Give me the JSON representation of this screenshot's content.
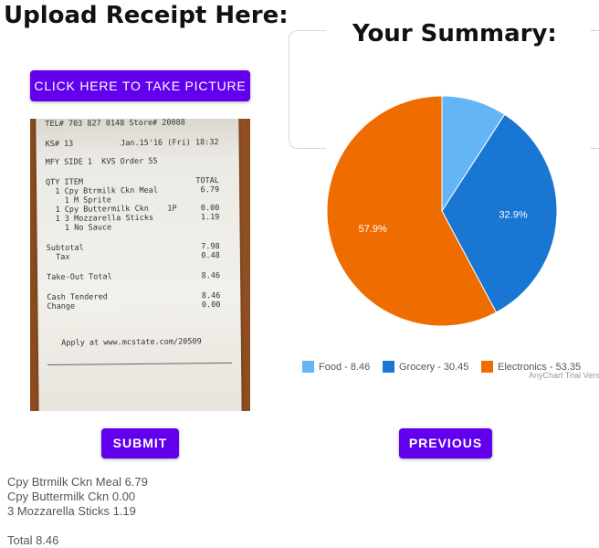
{
  "left_panel": {
    "heading": "Upload Receipt Here:",
    "take_picture_label": "CLICK HERE TO TAKE PICTURE",
    "submit_label": "SUBMIT",
    "receipt_photo": {
      "lines": [
        {
          "left": "TEL# 703 827 0148 Store# 20088",
          "right": ""
        },
        {
          "left": "KS# 13",
          "right": "Jan.15'16 (Fri) 18:32"
        },
        {
          "left": "MFY SIDE 1  KVS Order 55",
          "right": ""
        },
        {
          "left": "QTY ITEM",
          "right": "TOTAL"
        },
        {
          "left": "  1 Cpy Btrmilk Ckn Meal",
          "right": "6.79"
        },
        {
          "left": "    1 M Sprite",
          "right": ""
        },
        {
          "left": "  1 Cpy Buttermilk Ckn    1P",
          "right": "0.00"
        },
        {
          "left": "  1 3 Mozzarella Sticks",
          "right": "1.19"
        },
        {
          "left": "    1 No Sauce",
          "right": ""
        },
        {
          "left": "Subtotal",
          "right": "7.98"
        },
        {
          "left": "  Tax",
          "right": "0.48"
        },
        {
          "left": "Take-Out Total",
          "right": "8.46"
        },
        {
          "left": "Cash Tendered",
          "right": "8.46"
        },
        {
          "left": "Change",
          "right": "0.00"
        },
        {
          "left": "   Apply at www.mcstate.com/20509",
          "right": ""
        }
      ]
    },
    "parsed_items": [
      "Cpy Btrmilk Ckn Meal 6.79",
      "Cpy Buttermilk Ckn 0.00",
      "3 Mozzarella Sticks 1.19"
    ],
    "total_text": "Total 8.46"
  },
  "right_panel": {
    "heading": "Your Summary:",
    "previous_label": "PREVIOUS",
    "chart_credit": "AnyChart Trial Version"
  },
  "chart_data": {
    "type": "pie",
    "title": "",
    "labels": [
      "Food",
      "Grocery",
      "Electronics"
    ],
    "values": [
      8.46,
      30.45,
      53.35
    ],
    "legend_labels": [
      "Food - 8.46",
      "Grocery - 30.45",
      "Electronics - 53.35"
    ],
    "slice_labels": [
      "",
      "32.9%",
      "57.9%"
    ],
    "colors": [
      "#64b5f6",
      "#1976d2",
      "#ef6c00"
    ],
    "legend_position": "bottom",
    "start_angle_deg": 0,
    "direction": "clockwise"
  }
}
